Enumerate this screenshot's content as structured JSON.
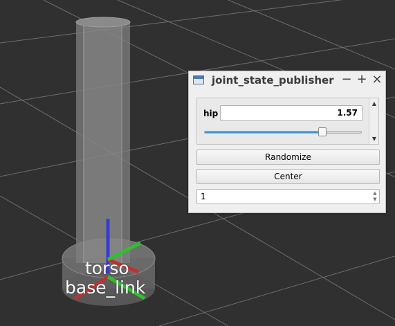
{
  "viewport": {
    "background": "#303030",
    "frame_labels": {
      "torso": "torso",
      "base_link": "base_link"
    }
  },
  "window": {
    "title": "joint_state_publisher",
    "icon": "app-window-icon",
    "controls": {
      "minimize": "−",
      "maximize": "+",
      "close": "×"
    }
  },
  "joints": {
    "hip": {
      "label": "hip",
      "value": "1.57",
      "slider_fraction": 0.75
    }
  },
  "buttons": {
    "randomize": "Randomize",
    "center": "Center"
  },
  "spin": {
    "value": "1"
  },
  "scroll_icons": {
    "up": "▲",
    "down": "▼"
  },
  "colors": {
    "slider_fill": "#3b94d9",
    "axis_x": "#c03030",
    "axis_y": "#2ec02e",
    "axis_z": "#3a3ad0"
  }
}
